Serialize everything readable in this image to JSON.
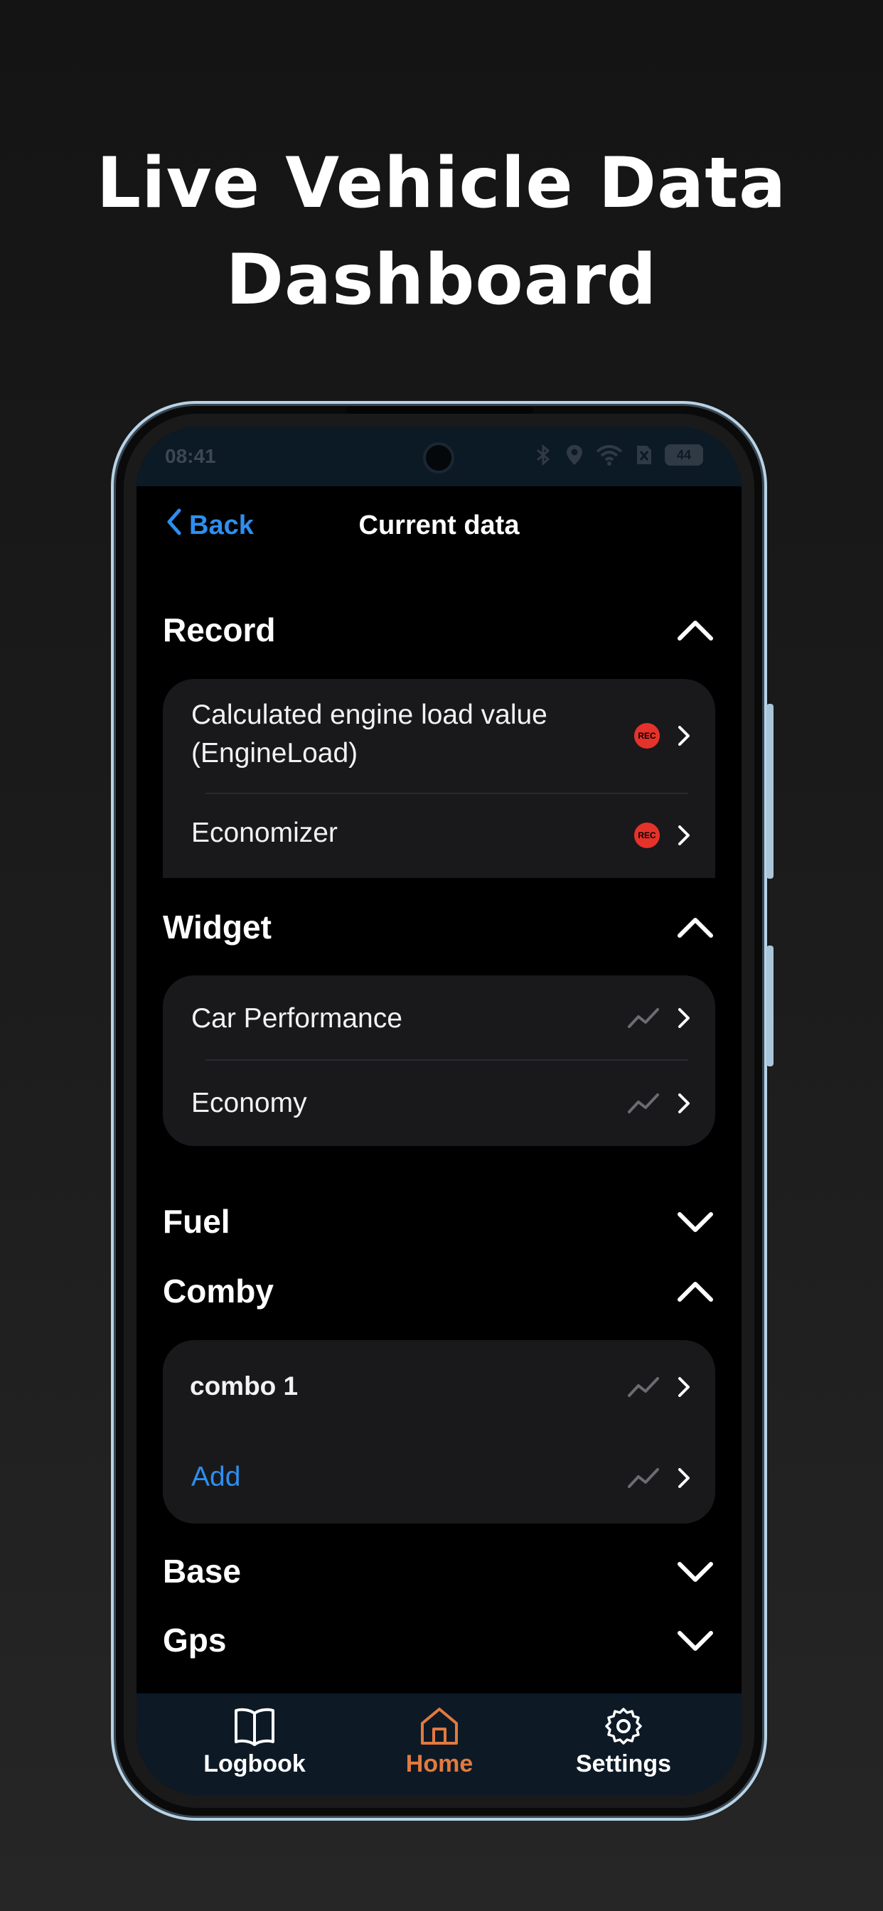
{
  "headline": {
    "line1": "Live Vehicle Data",
    "line2": "Dashboard"
  },
  "status_bar": {
    "time": "08:41",
    "battery": "44"
  },
  "nav": {
    "back_label": "Back",
    "title": "Current data"
  },
  "sections": {
    "record": {
      "title": "Record",
      "expanded": true,
      "items": [
        {
          "label_line1": "Calculated engine load value",
          "label_line2": "(EngineLoad)",
          "badge": "REC"
        },
        {
          "label": "Economizer",
          "badge": "REC"
        }
      ]
    },
    "widget": {
      "title": "Widget",
      "expanded": true,
      "items": [
        {
          "label": "Car Performance"
        },
        {
          "label": "Economy"
        }
      ]
    },
    "fuel": {
      "title": "Fuel",
      "expanded": false
    },
    "comby": {
      "title": "Comby",
      "expanded": true,
      "items": [
        {
          "label": "combo 1"
        },
        {
          "label": "Add"
        }
      ]
    },
    "base": {
      "title": "Base",
      "expanded": false
    },
    "gps": {
      "title": "Gps",
      "expanded": false
    }
  },
  "tabbar": {
    "tabs": [
      {
        "label": "Logbook",
        "icon": "book-icon"
      },
      {
        "label": "Home",
        "icon": "home-icon",
        "active": true
      },
      {
        "label": "Settings",
        "icon": "gear-icon"
      }
    ]
  },
  "colors": {
    "accent_blue": "#2d8ff0",
    "accent_orange": "#e27a3f",
    "rec_red": "#e5322b",
    "card_bg": "#19191c"
  }
}
